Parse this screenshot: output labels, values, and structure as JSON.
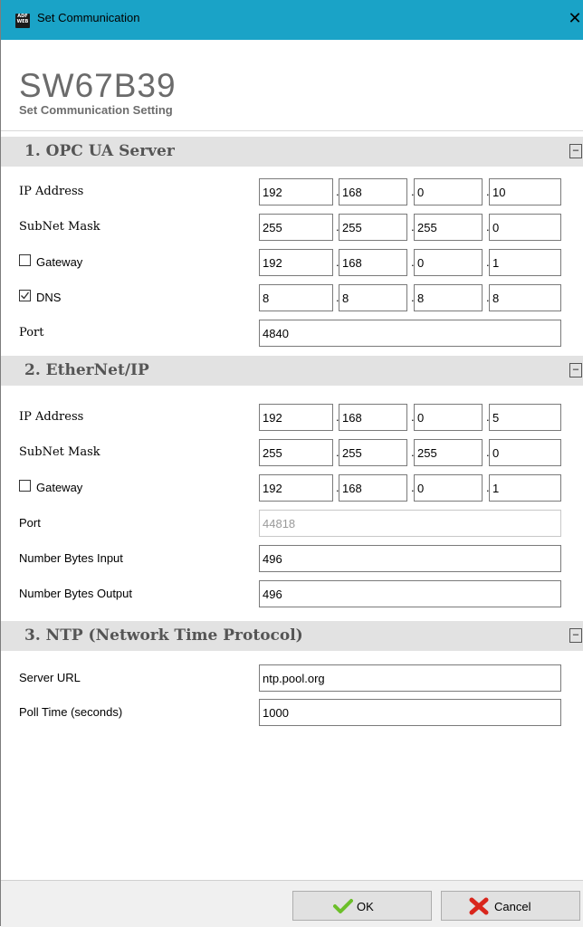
{
  "window": {
    "title": "Set Communication",
    "close_glyph": "✕",
    "icon_text": [
      "ADF",
      "WEB"
    ]
  },
  "header": {
    "product": "SW67B39",
    "subtitle": "Set Communication Setting"
  },
  "sections": {
    "opcua": {
      "title": "1. OPC UA Server",
      "collapse": "⊟",
      "ip_label": "IP Address",
      "ip": [
        "192",
        "168",
        "0",
        "10"
      ],
      "mask_label": "SubNet Mask",
      "mask": [
        "255",
        "255",
        "255",
        "0"
      ],
      "gateway_label": "Gateway",
      "gateway_checked": false,
      "gateway": [
        "192",
        "168",
        "0",
        "1"
      ],
      "dns_label": "DNS",
      "dns_checked": true,
      "dns": [
        "8",
        "8",
        "8",
        "8"
      ],
      "port_label": "Port",
      "port": "4840"
    },
    "ethernetip": {
      "title": "2. EtherNet/IP",
      "collapse": "⊟",
      "ip_label": "IP Address",
      "ip": [
        "192",
        "168",
        "0",
        "5"
      ],
      "mask_label": "SubNet Mask",
      "mask": [
        "255",
        "255",
        "255",
        "0"
      ],
      "gateway_label": "Gateway",
      "gateway_checked": false,
      "gateway": [
        "192",
        "168",
        "0",
        "1"
      ],
      "port_label": "Port",
      "port": "44818",
      "bytes_in_label": "Number Bytes Input",
      "bytes_in": "496",
      "bytes_out_label": "Number Bytes Output",
      "bytes_out": "496"
    },
    "ntp": {
      "title": "3. NTP (Network Time Protocol)",
      "collapse": "⊟",
      "server_label": "Server URL",
      "server": "ntp.pool.org",
      "poll_label": "Poll Time (seconds)",
      "poll": "1000"
    }
  },
  "footer": {
    "ok_label": "OK",
    "cancel_label": "Cancel"
  },
  "icons": {
    "ok": "check-icon",
    "cancel": "cross-icon",
    "colors": {
      "ok": "#6cbf2a",
      "cancel": "#d9261c",
      "titlebar": "#1aa3c7"
    }
  }
}
